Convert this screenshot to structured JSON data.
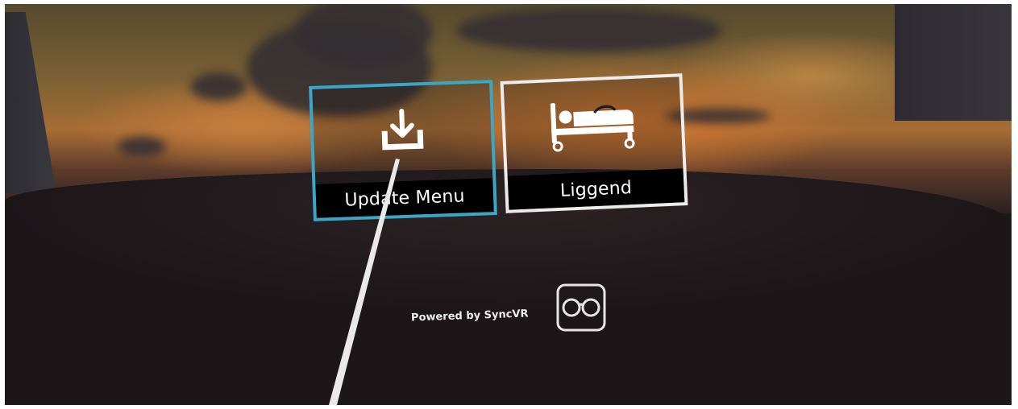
{
  "menu": {
    "items": [
      {
        "label": "Update Menu",
        "icon": "download-icon",
        "selected": true
      },
      {
        "label": "Liggend",
        "icon": "bed-patient-icon",
        "selected": false
      }
    ]
  },
  "footer": {
    "powered_by": "Powered by SyncVR",
    "logo_icon": "syncvr-logo-icon"
  },
  "colors": {
    "selected_border": "#3aa7c7",
    "default_border": "#ececec",
    "label_background": "#000000"
  }
}
